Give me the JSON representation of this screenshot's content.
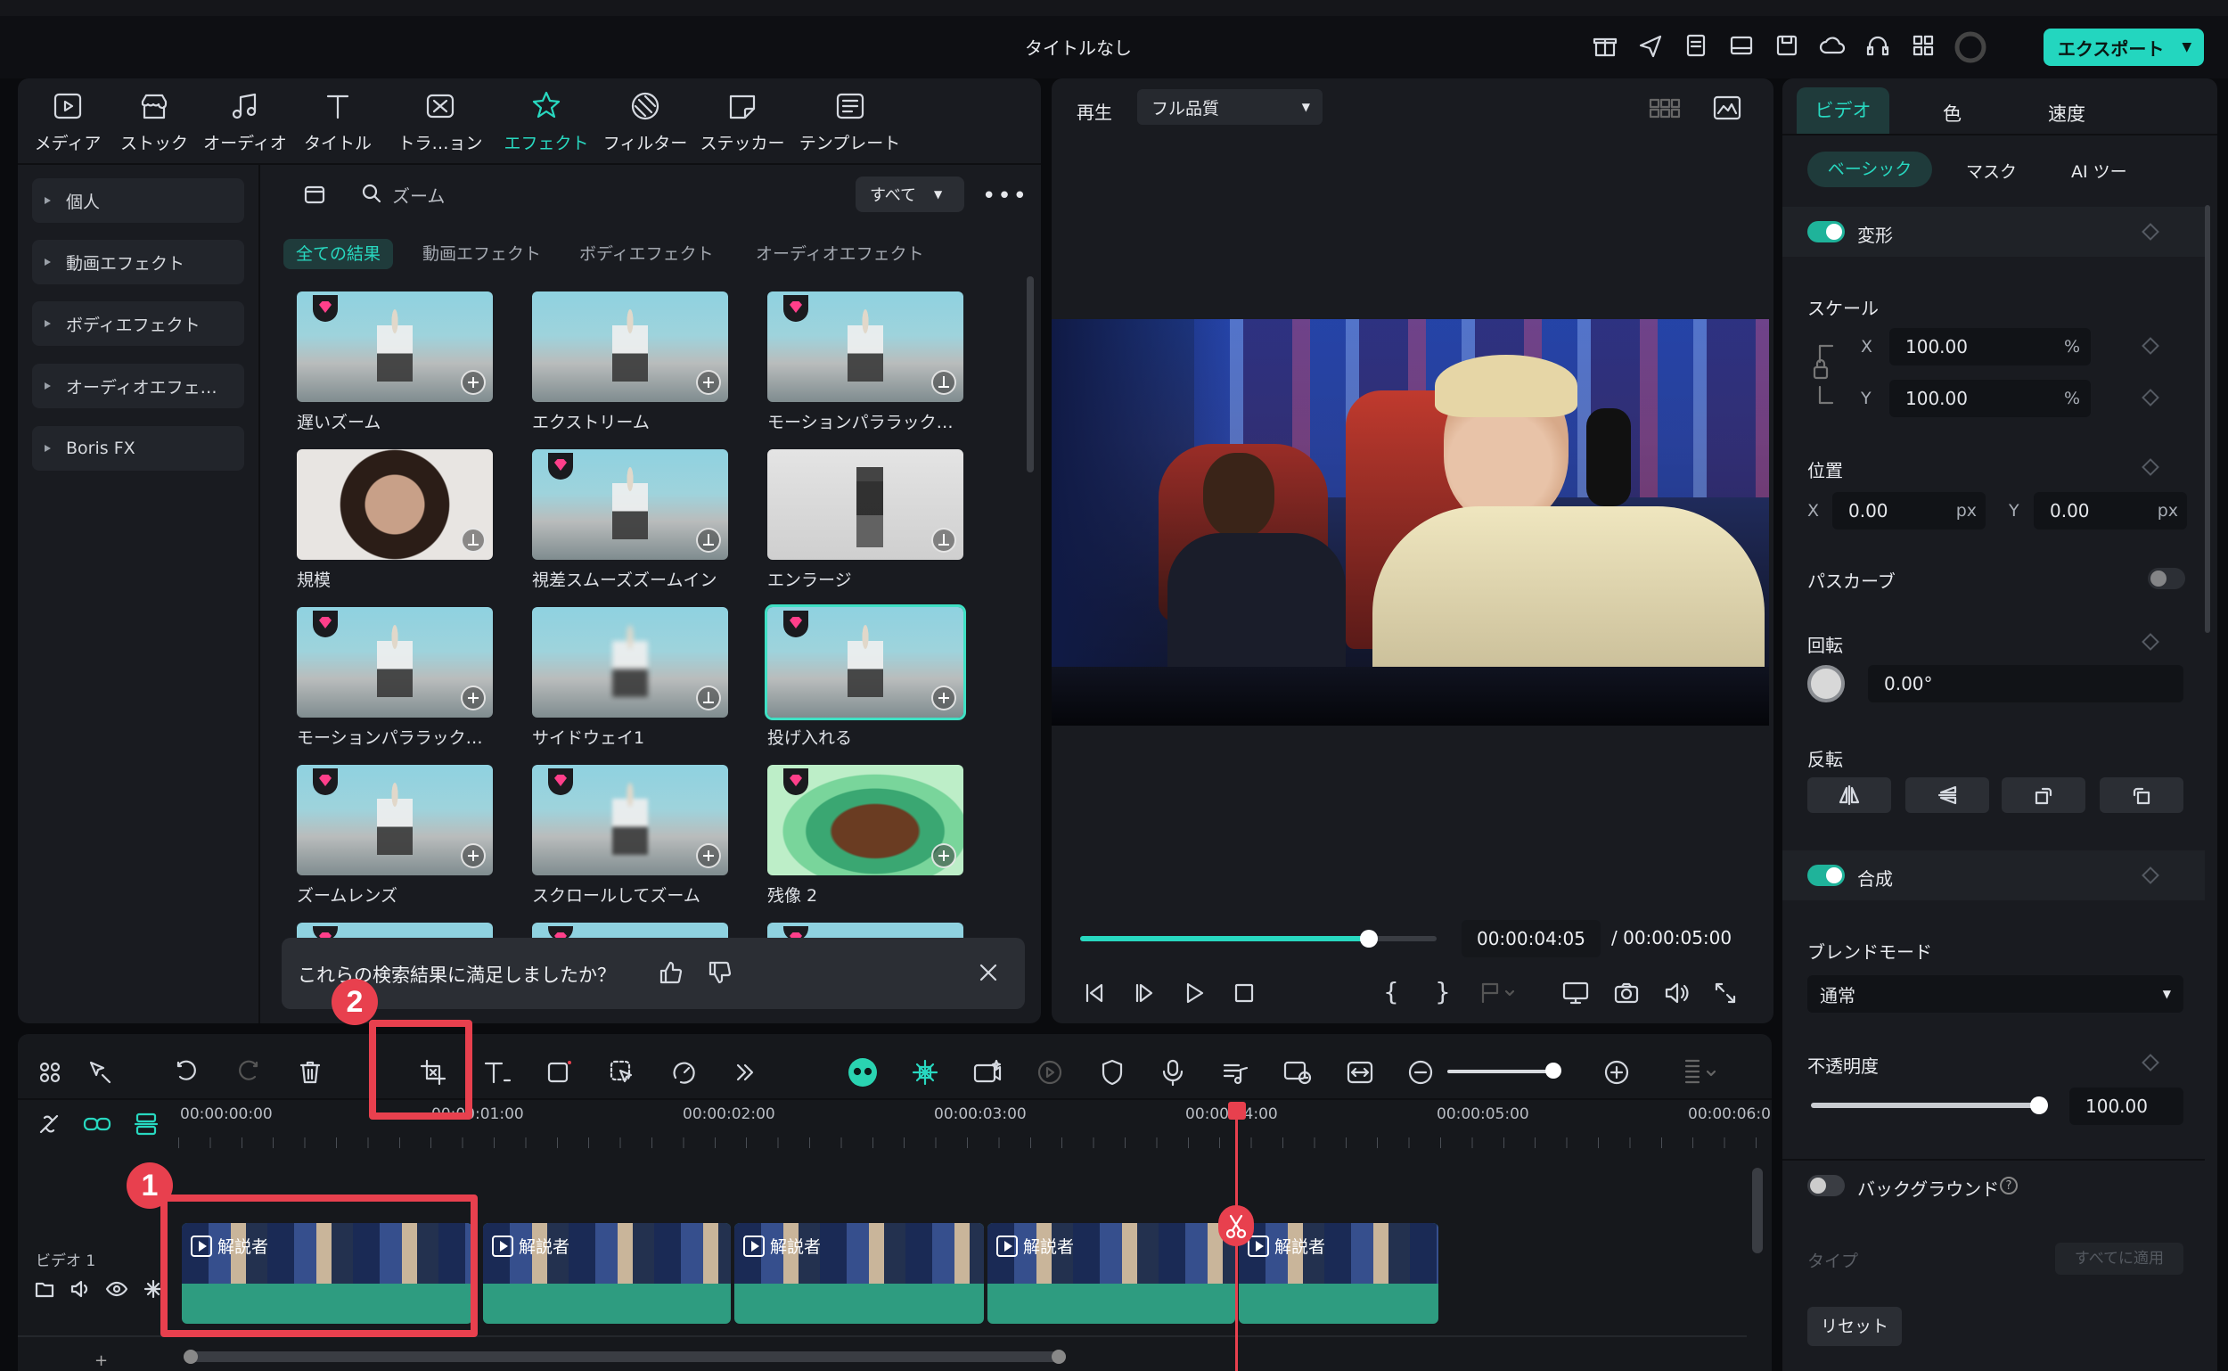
{
  "window": {
    "title": "タイトルなし",
    "export_label": "エクスポート"
  },
  "media_tabs": [
    {
      "label": "メディア",
      "icon": "media-icon"
    },
    {
      "label": "ストック",
      "icon": "stock-icon"
    },
    {
      "label": "オーディオ",
      "icon": "audio-icon"
    },
    {
      "label": "タイトル",
      "icon": "title-icon"
    },
    {
      "label": "トラ…ョン",
      "icon": "transition-icon"
    },
    {
      "label": "エフェクト",
      "icon": "effect-icon",
      "active": true
    },
    {
      "label": "フィルター",
      "icon": "filter-icon"
    },
    {
      "label": "ステッカー",
      "icon": "sticker-icon"
    },
    {
      "label": "テンプレート",
      "icon": "template-icon"
    }
  ],
  "categories": [
    "個人",
    "動画エフェクト",
    "ボディエフェクト",
    "オーディオエフェ…",
    "Boris FX"
  ],
  "search": {
    "value": "ズーム",
    "filter": "すべて"
  },
  "filter_tabs": [
    "全ての結果",
    "動画エフェクト",
    "ボディエフェクト",
    "オーディオエフェクト"
  ],
  "effects": [
    {
      "name": "遅いズーム"
    },
    {
      "name": "エクストリーム"
    },
    {
      "name": "モーションパララック…"
    },
    {
      "name": "規模"
    },
    {
      "name": "視差スムーズズームイン"
    },
    {
      "name": "エンラージ"
    },
    {
      "name": "モーションパララック…"
    },
    {
      "name": "サイドウェイ1"
    },
    {
      "name": "投げ入れる"
    },
    {
      "name": "ズームレンズ"
    },
    {
      "name": "スクロールしてズーム"
    },
    {
      "name": "残像 2"
    }
  ],
  "feedback": {
    "question": "これらの検索結果に満足しましたか？"
  },
  "player": {
    "play_label": "再生",
    "quality": "フル品質",
    "current_time": "00:00:04:05",
    "total_time": "/ 00:00:05:00",
    "progress": 0.81
  },
  "right_panel": {
    "tabs": [
      "ビデオ",
      "色",
      "速度"
    ],
    "subtabs": [
      "ベーシック",
      "マスク",
      "AI ツー"
    ],
    "transform_label": "変形",
    "scale_label": "スケール",
    "scale_x": "100.00",
    "scale_y": "100.00",
    "x_label": "X",
    "y_label": "Y",
    "percent": "%",
    "position_label": "位置",
    "pos_x": "0.00",
    "pos_y": "0.00",
    "px": "px",
    "path_curve_label": "パスカーブ",
    "rotation_label": "回転",
    "rotation": "0.00°",
    "flip_label": "反転",
    "composite_label": "合成",
    "blend_label": "ブレンドモード",
    "blend_value": "通常",
    "opacity_label": "不透明度",
    "opacity": "100.00",
    "background_label": "バックグラウンド",
    "type_label": "タイプ",
    "apply_all": "すべてに適用",
    "reset_label": "リセット"
  },
  "timeline": {
    "ruler": [
      "00:00:00:00",
      "00:00:01:00",
      "00:00:02:00",
      "00:00:03:00",
      "00:00:04:00",
      "00:00:05:00",
      "00:00:06:0"
    ],
    "track_label": "ビデオ 1",
    "clips": [
      "解説者",
      "解説者",
      "解説者",
      "解説者",
      "解説者"
    ]
  },
  "annotations": {
    "one": "1",
    "two": "2"
  },
  "colors": {
    "accent": "#28d8c0",
    "annotation": "#e8404e",
    "clip": "#2e9c80"
  }
}
